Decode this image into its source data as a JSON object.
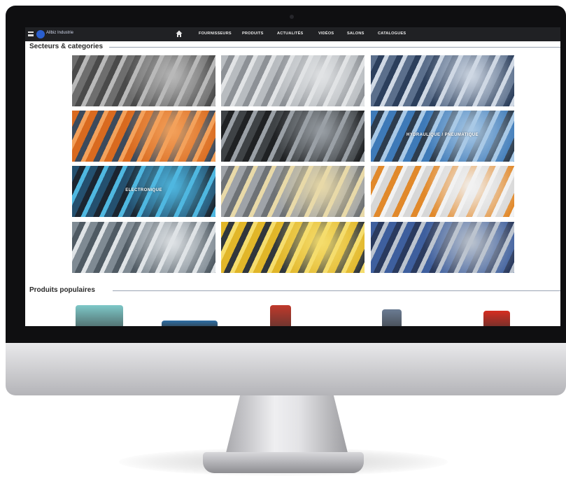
{
  "nav": {
    "logo_text": "Allbiz Industrie",
    "items": [
      "FOURNISSEURS",
      "PRODUITS",
      "ACTUALITÉS",
      "VIDÉOS",
      "SALONS",
      "CATALOGUES"
    ]
  },
  "sections": {
    "categories_title": "Secteurs & categories",
    "products_title": "Produits populaires"
  },
  "categories": [
    {
      "label": "",
      "colors": [
        "#6e6e6e",
        "#b9b9b9",
        "#4a4a4a"
      ]
    },
    {
      "label": "",
      "colors": [
        "#b8bcc0",
        "#e1e3e5",
        "#8d9196"
      ]
    },
    {
      "label": "",
      "colors": [
        "#5b6f8c",
        "#cfd8e4",
        "#2c3f5c"
      ]
    },
    {
      "label": "",
      "colors": [
        "#d96a1f",
        "#f3a15b",
        "#3b4a5c"
      ]
    },
    {
      "label": "",
      "colors": [
        "#3f4346",
        "#9aa0a6",
        "#1f2123"
      ]
    },
    {
      "label": "HYDRAULIQUE / PNEUMATIQUE",
      "colors": [
        "#3e7ab8",
        "#a9c9e6",
        "#2d3c4d"
      ]
    },
    {
      "label": "ELECTRONIQUE",
      "colors": [
        "#24506f",
        "#4fb7e0",
        "#1b2530"
      ]
    },
    {
      "label": "",
      "colors": [
        "#9fa3a8",
        "#e8d9a8",
        "#6e7276"
      ]
    },
    {
      "label": "",
      "colors": [
        "#d7d7d7",
        "#f2f2f2",
        "#e1892b"
      ]
    },
    {
      "label": "",
      "colors": [
        "#7f8a93",
        "#dfe3e6",
        "#4f5a63"
      ]
    },
    {
      "label": "",
      "colors": [
        "#e1b629",
        "#f5dd6d",
        "#30363c"
      ]
    },
    {
      "label": "",
      "colors": [
        "#3e5f9e",
        "#bcc4cf",
        "#2a3a5e"
      ]
    }
  ],
  "products": [
    {
      "color": "#7ec8c8"
    },
    {
      "color": "#2d6fa6"
    },
    {
      "color": "#c0392b"
    },
    {
      "color": "#6b7c93"
    },
    {
      "color": "#d62d20"
    }
  ]
}
